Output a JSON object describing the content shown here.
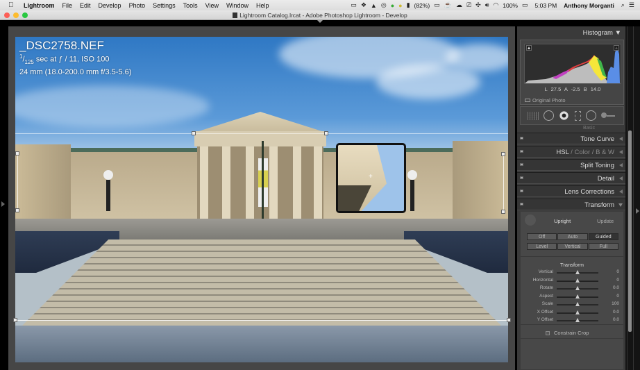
{
  "menubar": {
    "apple": "",
    "app": "Lightroom",
    "items": [
      "File",
      "Edit",
      "Develop",
      "Photo",
      "Settings",
      "Tools",
      "View",
      "Window",
      "Help"
    ],
    "battery_pct": "(82%)",
    "status_battery": "100%",
    "time": "5:03 PM",
    "user": "Anthony Morganti",
    "icons": [
      "screen-record-icon",
      "dropbox-icon",
      "google-drive-icon",
      "creative-cloud-icon",
      "evernote-icon",
      "skype-icon",
      "battery-app-icon",
      "menu-icon",
      "coffee-icon",
      "cloud-icon",
      "airplay-icon",
      "bluetooth-icon",
      "volume-icon",
      "wifi-icon",
      "battery-icon",
      "search-icon",
      "list-icon"
    ]
  },
  "window": {
    "title": "Lightroom Catalog.lrcat - Adobe Photoshop Lightroom - Develop"
  },
  "photo": {
    "filename": "_DSC2758.NEF",
    "shutter_num": "1",
    "shutter_den": "125",
    "exposure_rest": " sec at ƒ / 11, ISO 100",
    "lens": "24 mm (18.0-200.0 mm f/3.5-5.6)"
  },
  "histogram": {
    "title": "Histogram",
    "l_label": "L",
    "l_value": "27.5",
    "a_label": "A",
    "a_value": "-2.5",
    "b_label": "B",
    "b_value": "14.0",
    "original_photo": "Original Photo"
  },
  "tools": [
    "crop-overlay-icon",
    "spot-removal-icon",
    "red-eye-icon",
    "graduated-filter-icon",
    "radial-filter-icon",
    "adjustment-brush-icon"
  ],
  "sections": [
    {
      "name": "Tone Curve"
    },
    {
      "name_main": "HSL",
      "name_sep1": " / ",
      "name_color": "Color",
      "name_sep2": " / ",
      "name_bw": "B & W"
    },
    {
      "name": "Split Toning"
    },
    {
      "name": "Detail"
    },
    {
      "name": "Lens Corrections"
    },
    {
      "name": "Transform"
    }
  ],
  "peek_label": "Basic",
  "transform": {
    "upright_label": "Upright",
    "update_label": "Update",
    "upright_buttons_row1": [
      "Off",
      "Auto",
      "Guided"
    ],
    "upright_buttons_row2": [
      "Level",
      "Vertical",
      "Full"
    ],
    "active_upright": "Guided",
    "subtitle": "Transform",
    "sliders": [
      {
        "label": "Vertical",
        "value": "0",
        "position": 0.5
      },
      {
        "label": "Horizontal",
        "value": "0",
        "position": 0.5
      },
      {
        "label": "Rotate",
        "value": "0.0",
        "position": 0.5
      },
      {
        "label": "Aspect",
        "value": "0",
        "position": 0.5
      },
      {
        "label": "Scale",
        "value": "100",
        "position": 0.5
      },
      {
        "label": "X Offset",
        "value": "0.0",
        "position": 0.5
      },
      {
        "label": "Y Offset",
        "value": "0.0",
        "position": 0.5
      }
    ],
    "constrain_crop": "Constrain Crop",
    "constrain_checked": false
  },
  "colors": {
    "accent_bg": "#3a3a3a",
    "sky": "#2f78c4"
  }
}
